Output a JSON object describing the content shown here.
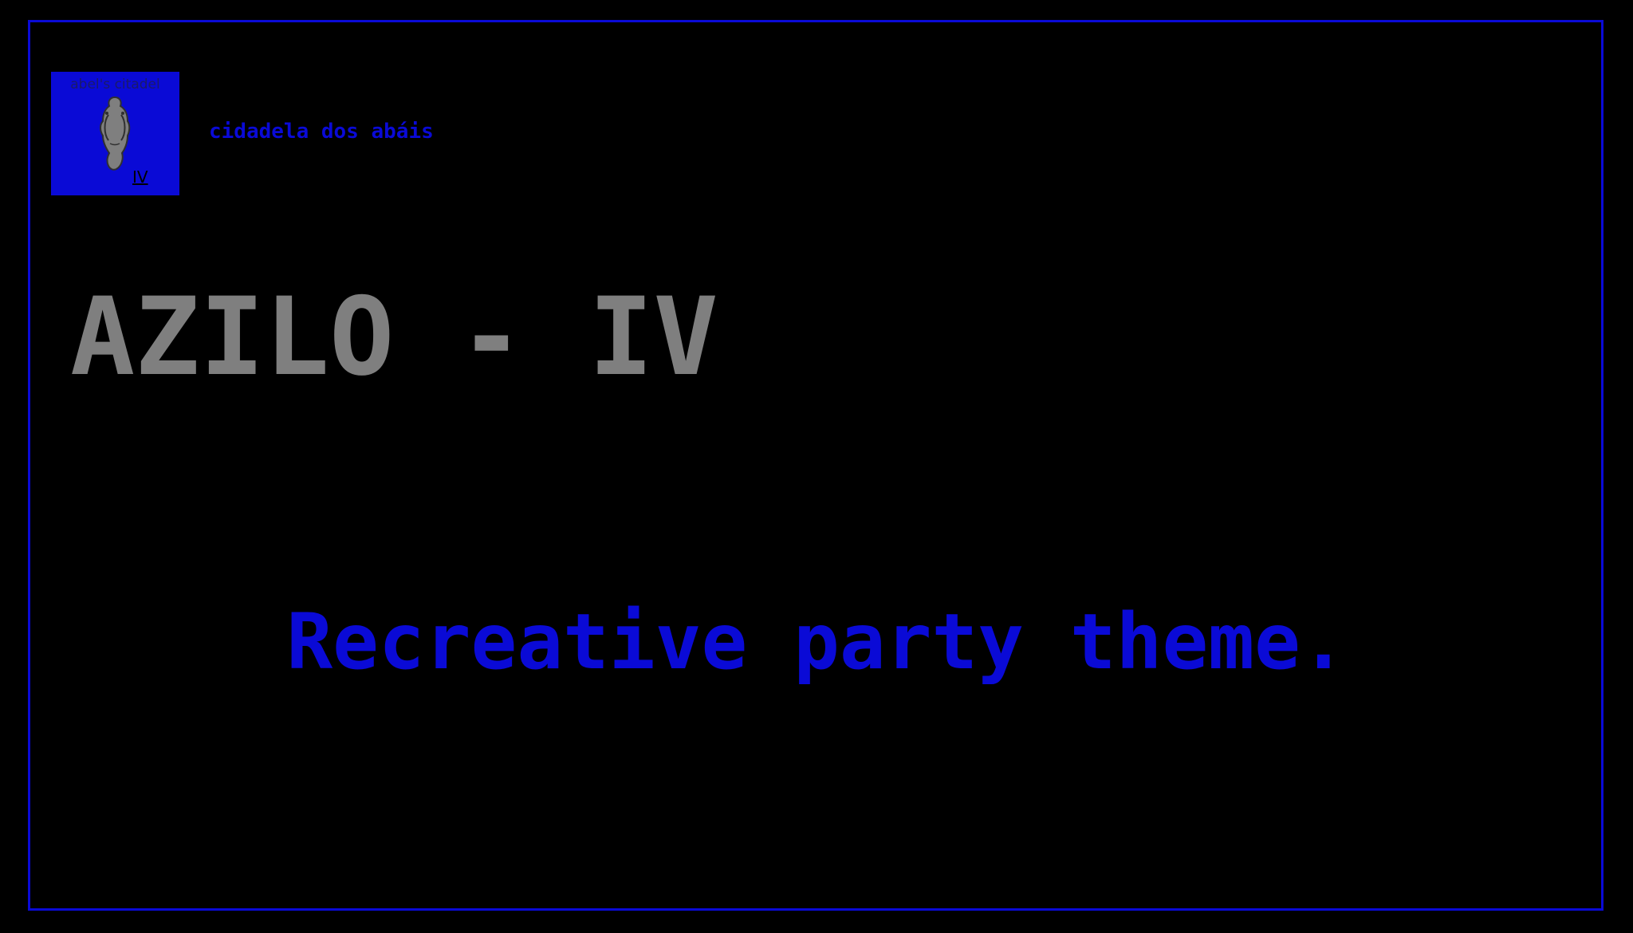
{
  "logo": {
    "top_text": "abel's citadel",
    "numeral": "IV",
    "background_color": "#0a0ad6",
    "figure_icon": "abbot-figure-icon"
  },
  "brand": {
    "name": "cidadela dos abáis"
  },
  "main": {
    "title": "AZILO - IV",
    "tagline": "Recreative party theme."
  },
  "colors": {
    "accent": "#0a0ad6",
    "title": "#7f7f7f",
    "background": "#000000"
  }
}
